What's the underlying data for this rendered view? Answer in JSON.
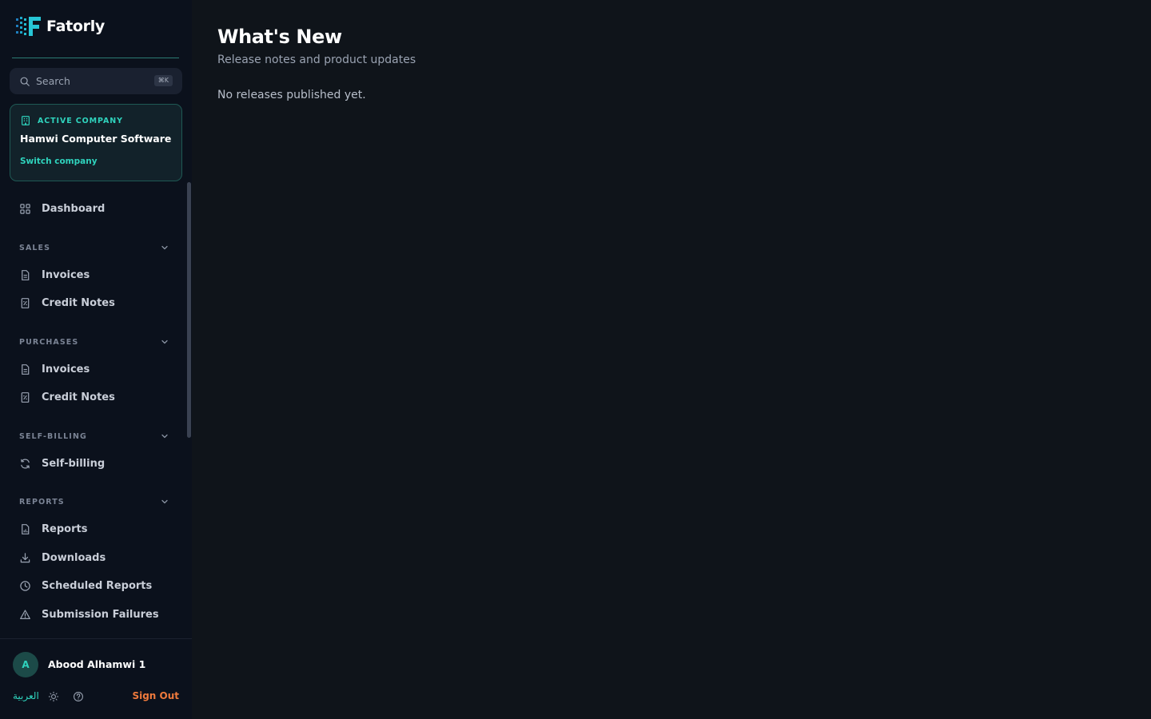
{
  "app": {
    "name": "Fatorly",
    "colors": {
      "accent": "#2fd3bd",
      "sidebar_bg": "#0b111c",
      "main_bg": "#0f141a",
      "signout": "#ef7a3c"
    }
  },
  "search": {
    "placeholder": "Search",
    "shortcut": "⌘K"
  },
  "company": {
    "label": "ACTIVE COMPANY",
    "name": "Hamwi Computer Software",
    "switch_label": "Switch company"
  },
  "nav": {
    "dashboard": {
      "label": "Dashboard",
      "icon": "grid-icon"
    },
    "sales": {
      "label": "SALES",
      "items": [
        {
          "label": "Invoices",
          "icon": "document-icon"
        },
        {
          "label": "Credit Notes",
          "icon": "receipt-icon"
        }
      ]
    },
    "purchases": {
      "label": "PURCHASES",
      "items": [
        {
          "label": "Invoices",
          "icon": "document-icon"
        },
        {
          "label": "Credit Notes",
          "icon": "receipt-icon"
        }
      ]
    },
    "self_billing": {
      "label": "SELF-BILLING",
      "items": [
        {
          "label": "Self-billing",
          "icon": "refresh-icon"
        }
      ]
    },
    "reports": {
      "label": "REPORTS",
      "items": [
        {
          "label": "Reports",
          "icon": "report-icon"
        },
        {
          "label": "Downloads",
          "icon": "download-icon"
        },
        {
          "label": "Scheduled Reports",
          "icon": "clock-icon"
        },
        {
          "label": "Submission Failures",
          "icon": "warning-icon"
        }
      ]
    }
  },
  "user": {
    "initial": "A",
    "name": "Abood Alhamwi 1"
  },
  "footer": {
    "language_label": "العربية",
    "sign_out_label": "Sign Out"
  },
  "main": {
    "title": "What's New",
    "subtitle": "Release notes and product updates",
    "empty_message": "No releases published yet."
  }
}
